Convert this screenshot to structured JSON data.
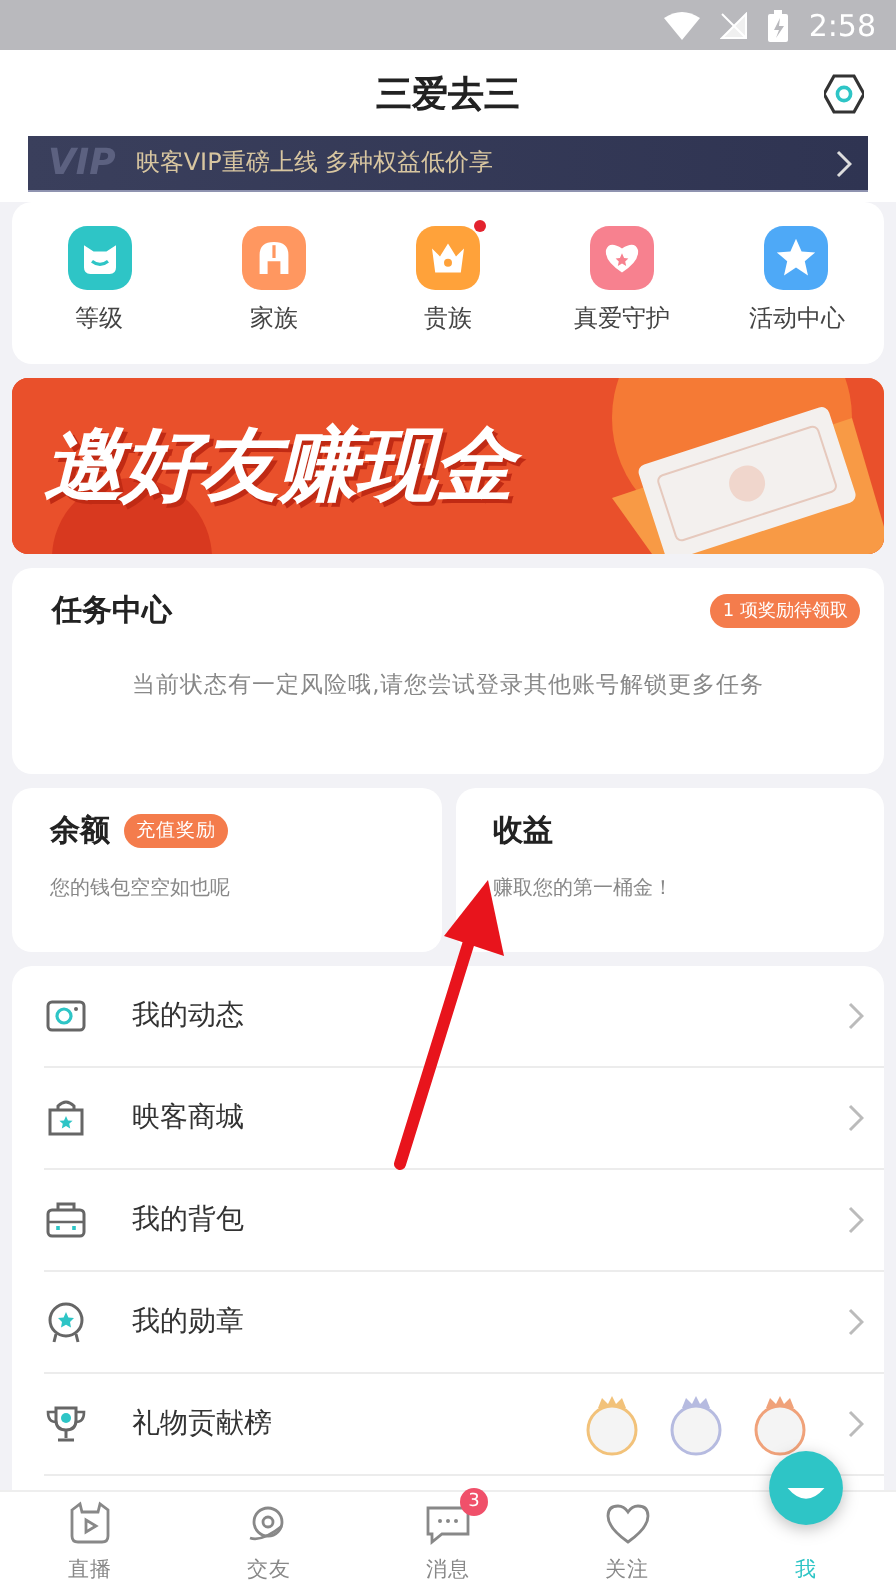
{
  "status_bar": {
    "time": "2:58"
  },
  "header": {
    "title": "三爱去三"
  },
  "vip_banner": {
    "logo": "VIP",
    "text": "映客VIP重磅上线 多种权益低价享"
  },
  "shortcuts": [
    {
      "label": "等级",
      "color": "#2ec5c6",
      "dot": false
    },
    {
      "label": "家族",
      "color": "#ff9760",
      "dot": false
    },
    {
      "label": "贵族",
      "color": "#ffa23a",
      "dot": true
    },
    {
      "label": "真爱守护",
      "color": "#f7818f",
      "dot": false
    },
    {
      "label": "活动中心",
      "color": "#4ea9f7",
      "dot": false
    }
  ],
  "promo_banner": {
    "text": "邀好友赚现金"
  },
  "task_center": {
    "title": "任务中心",
    "badge": "1 项奖励待领取",
    "message": "当前状态有一定风险哦,请您尝试登录其他账号解锁更多任务"
  },
  "balance": {
    "title": "余额",
    "badge": "充值奖励",
    "text": "您的钱包空空如也呢"
  },
  "earnings": {
    "title": "收益",
    "text": "赚取您的第一桶金！"
  },
  "menu": [
    {
      "label": "我的动态",
      "kind": "moments"
    },
    {
      "label": "映客商城",
      "kind": "shop"
    },
    {
      "label": "我的背包",
      "kind": "bag"
    },
    {
      "label": "我的勋章",
      "kind": "medal"
    },
    {
      "label": "礼物贡献榜",
      "kind": "ranking"
    }
  ],
  "tab_bar": [
    {
      "label": "直播",
      "kind": "live",
      "selected": false
    },
    {
      "label": "交友",
      "kind": "friends",
      "selected": false
    },
    {
      "label": "消息",
      "kind": "messages",
      "selected": false,
      "badge": "3"
    },
    {
      "label": "关注",
      "kind": "follow",
      "selected": false
    },
    {
      "label": "我",
      "kind": "me",
      "selected": true
    }
  ]
}
